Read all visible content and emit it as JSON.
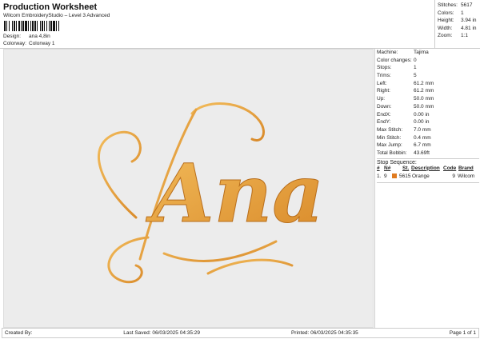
{
  "header": {
    "title": "Production Worksheet",
    "subtitle": "Wilcom EmbroideryStudio – Level 3 Advanced",
    "design_label": "Design:",
    "design_value": "ana 4,8in",
    "colorway_label": "Colorway:",
    "colorway_value": "Colorway 1"
  },
  "summary": [
    {
      "k": "Stitches:",
      "v": "5617"
    },
    {
      "k": "Colors:",
      "v": "1"
    },
    {
      "k": "Height:",
      "v": "3.94 in"
    },
    {
      "k": "Width:",
      "v": "4.81 in"
    },
    {
      "k": "Zoom:",
      "v": "1:1"
    }
  ],
  "design": {
    "lettering": "Ana",
    "thread_color": "#e8a040"
  },
  "details": [
    {
      "k": "Machine:",
      "v": "Tajima"
    },
    {
      "k": "Color changes:",
      "v": "0"
    },
    {
      "k": "Stops:",
      "v": "1"
    },
    {
      "k": "Trims:",
      "v": "5"
    },
    {
      "k": "Left:",
      "v": "61.2 mm"
    },
    {
      "k": "Right:",
      "v": "61.2 mm"
    },
    {
      "k": "Up:",
      "v": "50.0 mm"
    },
    {
      "k": "Down:",
      "v": "50.0 mm"
    },
    {
      "k": "EndX:",
      "v": "0.00 in"
    },
    {
      "k": "EndY:",
      "v": "0.00 in"
    },
    {
      "k": "Max Stitch:",
      "v": "7.0 mm"
    },
    {
      "k": "Min Stitch:",
      "v": "0.4 mm"
    },
    {
      "k": "Max Jump:",
      "v": "6.7 mm"
    },
    {
      "k": "Total Bobbin:",
      "v": "43.69ft"
    }
  ],
  "stop_sequence": {
    "title": "Stop Sequence:",
    "headers": [
      "#",
      "N#",
      "St.",
      "Description",
      "Code",
      "Brand"
    ],
    "rows": [
      {
        "num": "1.",
        "n": "9",
        "swatch": "#e07b20",
        "st": "5615",
        "desc": "Orange",
        "code": "9",
        "brand": "Wilcom"
      }
    ]
  },
  "footer": {
    "created": "Created By:",
    "saved": "Last Saved: 06/03/2025 04:35:29",
    "printed": "Printed: 06/03/2025 04:35:35",
    "page": "Page 1 of 1"
  }
}
